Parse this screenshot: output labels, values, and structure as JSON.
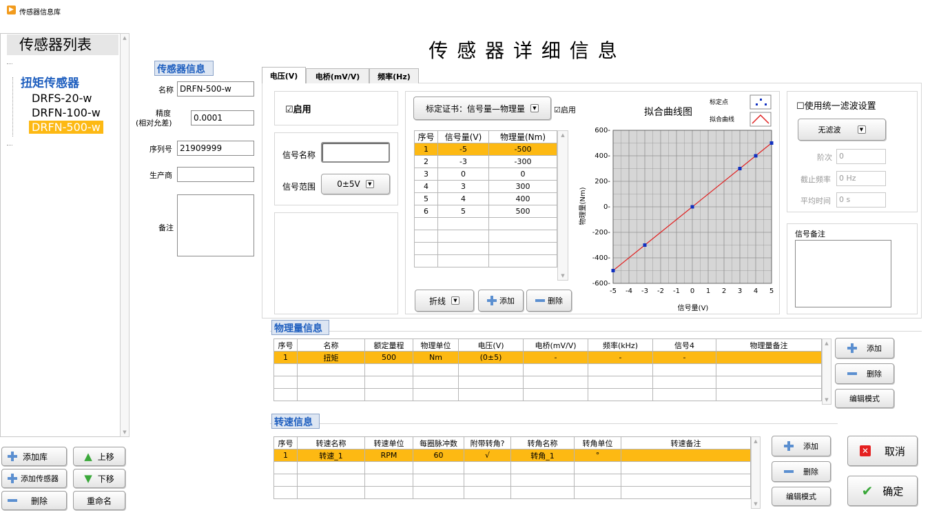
{
  "window": {
    "title": "传感器信息库"
  },
  "page_title": "传 感 器 详 细 信 息",
  "left": {
    "list_header": "传感器列表",
    "tree_group": "扭矩传感器",
    "tree_items": [
      "DRFS-20-w",
      "DRFN-100-w",
      "DRFN-500-w"
    ],
    "selected_item": "DRFN-500-w",
    "buttons": {
      "add_lib": "添加库",
      "move_up": "上移",
      "add_sensor": "添加传感器",
      "move_down": "下移",
      "delete": "删除",
      "rename": "重命名"
    }
  },
  "sensor_info": {
    "title": "传感器信息",
    "name_label": "名称",
    "name_value": "DRFN-500-w",
    "precision_label": "精度",
    "precision_sub": "(相对允差)",
    "precision_value": "0.0001",
    "serial_label": "序列号",
    "serial_value": "21909999",
    "maker_label": "生产商",
    "maker_value": "",
    "note_label": "备注",
    "note_value": ""
  },
  "tabs": [
    "电压(V)",
    "电桥(mV/V)",
    "频率(Hz)"
  ],
  "voltage": {
    "enable_label": "☑启用",
    "signal_name_label": "信号名称",
    "signal_name_value": "",
    "signal_range_label": "信号范围",
    "signal_range_value": "0±5V",
    "cert_label": "标定证书：信号量—物理量",
    "cert_enable_label": "☑启用",
    "table_headers": [
      "序号",
      "信号量(V)",
      "物理量(Nm)"
    ],
    "table_rows": [
      [
        "1",
        "-5",
        "-500"
      ],
      [
        "2",
        "-3",
        "-300"
      ],
      [
        "3",
        "0",
        "0"
      ],
      [
        "4",
        "3",
        "300"
      ],
      [
        "5",
        "4",
        "400"
      ],
      [
        "6",
        "5",
        "500"
      ]
    ],
    "fit_mode": "折线",
    "add_label": "添加",
    "delete_label": "删除"
  },
  "chart_data": {
    "type": "scatter",
    "title": "拟合曲线图",
    "xlabel": "信号量(V)",
    "ylabel": "物理量(Nm)",
    "xlim": [
      -5,
      5
    ],
    "ylim": [
      -600,
      600
    ],
    "x_ticks": [
      -5,
      -4,
      -3,
      -2,
      -1,
      0,
      1,
      2,
      3,
      4,
      5
    ],
    "y_ticks": [
      600,
      400,
      200,
      0,
      -200,
      -400,
      -600
    ],
    "grid": true,
    "legend": {
      "placement": "top-right",
      "entries": [
        "标定点",
        "拟合曲线"
      ]
    },
    "series": [
      {
        "name": "标定点",
        "x": [
          -5,
          -3,
          0,
          3,
          4,
          5
        ],
        "y": [
          -500,
          -300,
          0,
          300,
          400,
          500
        ],
        "color": "#1030c0"
      },
      {
        "name": "拟合曲线",
        "x": [
          -5,
          -3,
          0,
          3,
          4,
          5
        ],
        "y": [
          -500,
          -300,
          0,
          300,
          400,
          500
        ],
        "color": "#e02020"
      }
    ]
  },
  "filter": {
    "unified_label": "☐使用统一滤波设置",
    "filter_value": "无滤波",
    "order_label": "阶次",
    "order_value": "0",
    "cutoff_label": "截止频率",
    "cutoff_value": "0 Hz",
    "avg_label": "平均时间",
    "avg_value": "0 s",
    "signal_note_label": "信号备注"
  },
  "physical": {
    "title": "物理量信息",
    "headers": [
      "序号",
      "名称",
      "额定量程",
      "物理单位",
      "电压(V)",
      "电桥(mV/V)",
      "频率(kHz)",
      "信号4",
      "物理量备注"
    ],
    "rows": [
      [
        "1",
        "扭矩",
        "500",
        "Nm",
        "(0±5)",
        "-",
        "-",
        "-",
        ""
      ]
    ],
    "add_label": "添加",
    "delete_label": "删除",
    "edit_label": "编辑模式"
  },
  "speed": {
    "title": "转速信息",
    "headers": [
      "序号",
      "转速名称",
      "转速单位",
      "每圈脉冲数",
      "附带转角?",
      "转角名称",
      "转角单位",
      "转速备注"
    ],
    "rows": [
      [
        "1",
        "转速_1",
        "RPM",
        "60",
        "√",
        "转角_1",
        "°",
        ""
      ]
    ],
    "add_label": "添加",
    "delete_label": "删除",
    "edit_label": "编辑模式"
  },
  "actions": {
    "cancel": "取消",
    "ok": "确定"
  },
  "colors": {
    "selection": "#fdb913",
    "accent_blue": "#1f5fbf",
    "fit_line": "#e02020",
    "points": "#1030c0"
  }
}
